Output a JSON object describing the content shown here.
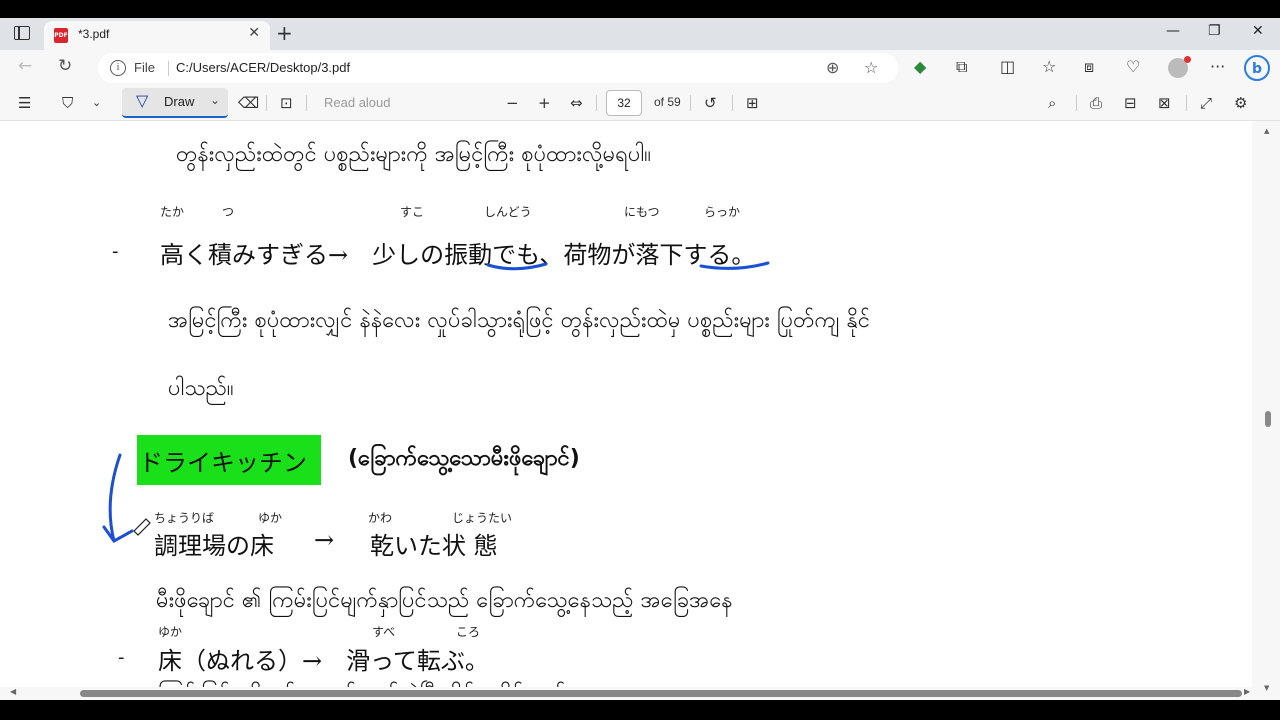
{
  "browser": {
    "tab": {
      "title": "*3.pdf",
      "icon": "pdf-file-icon",
      "close": "✕"
    },
    "new_tab": "+",
    "window_controls": {
      "minimize": "—",
      "restore": "❐",
      "close": "✕"
    },
    "address": {
      "scheme_label": "File",
      "url": "C:/Users/ACER/Desktop/3.pdf"
    }
  },
  "pdf_toolbar": {
    "draw_label": "Draw",
    "read_aloud_label": "Read aloud",
    "page_current": "32",
    "page_total_label": "of 59"
  },
  "document": {
    "line1": "တွန်းလှည်းထဲတွင် ပစ္စည်းများကို အမြင့်ကြီး စုပုံထားလို့မရပါ။",
    "bullet1": {
      "dash": "-",
      "furigana": [
        "たか",
        "つ",
        "すこ",
        "しんどう",
        "にもつ",
        "らっか"
      ],
      "text": "高く積みすぎる→　少しの振動でも、荷物が落下する。"
    },
    "line2": "အမြင့်ကြီး စုပုံထားလျှင် နဲနဲလေး လှုပ်ခါသွားရုံဖြင့် တွန်းလှည်းထဲမှ ပစ္စည်းများ ပြုတ်ကျ နိုင်",
    "line3": "ပါသည်။",
    "heading": {
      "highlight": "ドライキッチン",
      "myanmar": "(ခြောက်သွေ့သောမီးဖိုချောင်)"
    },
    "term": {
      "furigana": [
        "ちょうりば",
        "ゆか",
        "かわ",
        "じょうたい"
      ],
      "left": "調理場の床",
      "arrow": "→",
      "right": "乾いた状 態"
    },
    "line4": "မီးဖိုချောင် ၏ ကြမ်းပြင်မျက်နှာပြင်သည်  ခြောက်သွေ့နေသည့် အခြေအနေ",
    "bullet2": {
      "dash": "-",
      "furigana": [
        "ゆか",
        "すべ",
        "ころ"
      ],
      "text": "床（ぬれる）→　滑って転ぶ。"
    },
    "line5": "ကြမ်းပြင်မှ စိုစွတ်နေလျှင် ချော်လဲပြီးလိမ့်ကျနိုင်သည်။"
  },
  "colors": {
    "highlight": "#19e019",
    "ink": "#1a4fd6",
    "accent": "#1a63c7"
  }
}
